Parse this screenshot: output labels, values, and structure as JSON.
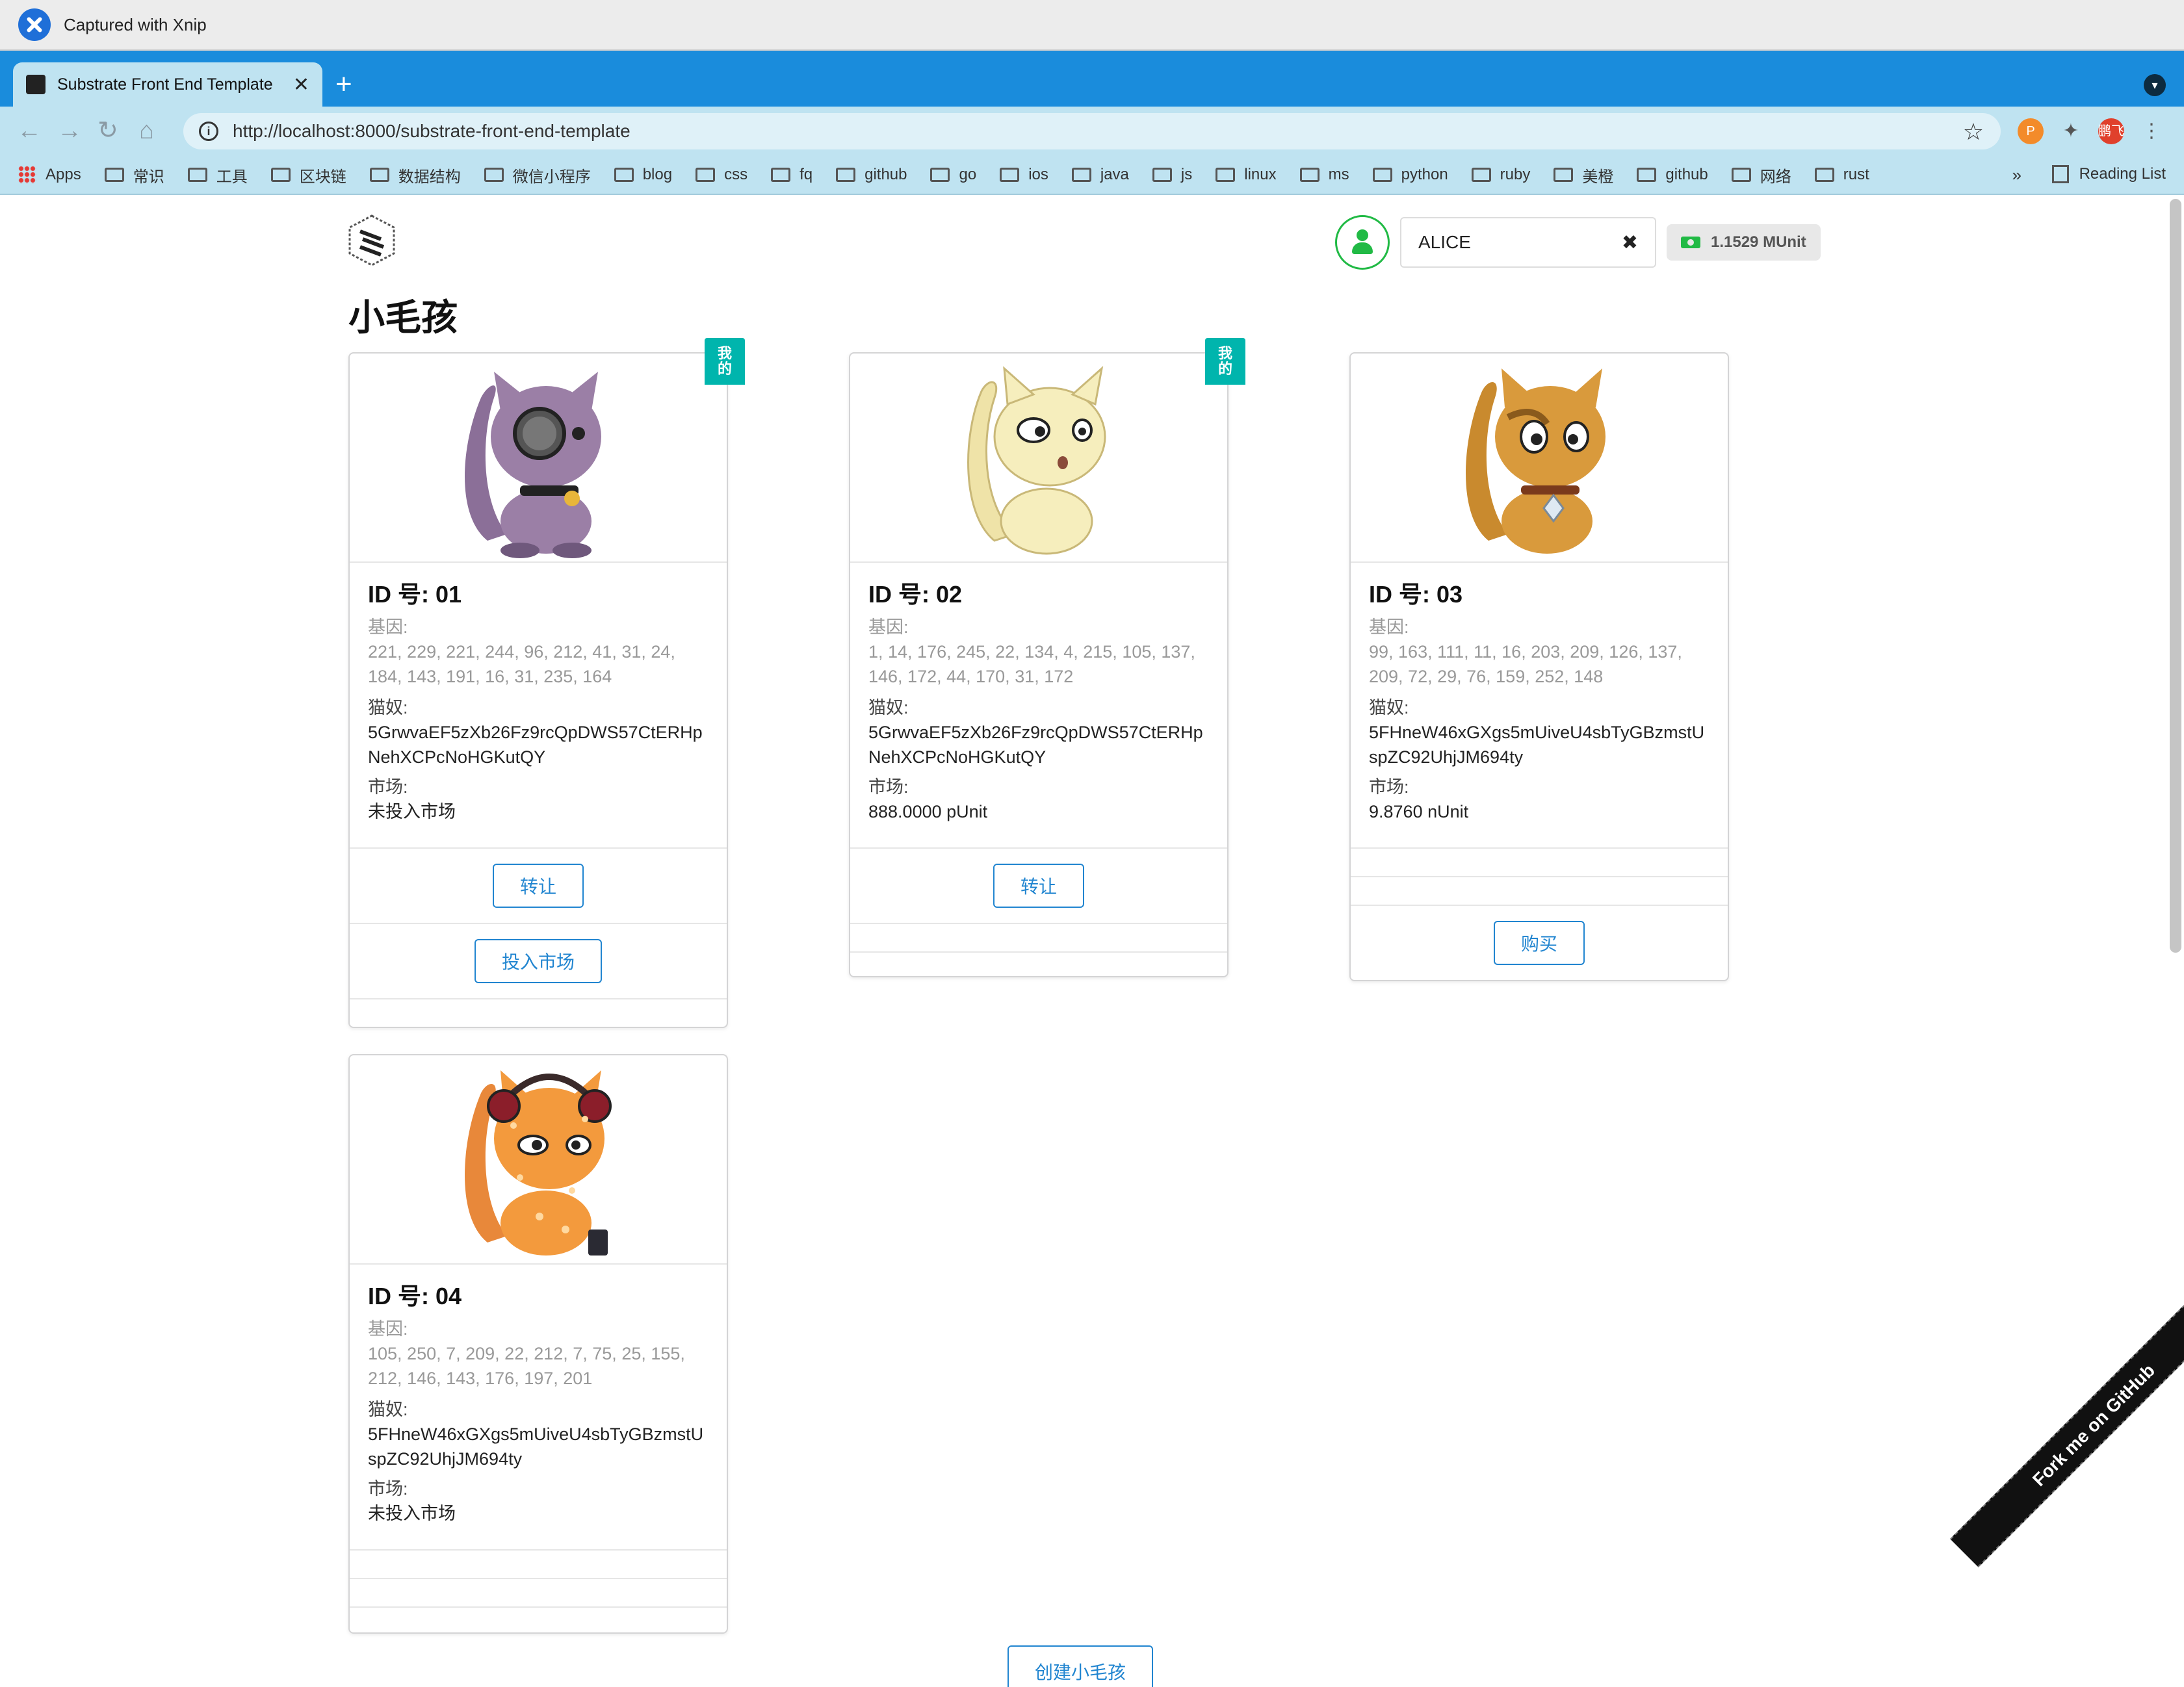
{
  "capture": {
    "title": "Captured with Xnip"
  },
  "browser": {
    "tab_title": "Substrate Front End Template",
    "tab_close": "✕",
    "new_tab": "+",
    "url": "http://localhost:8000/substrate-front-end-template",
    "ext_avatar_label": "鹏飞",
    "bookmarks": [
      "Apps",
      "常识",
      "工具",
      "区块链",
      "数据结构",
      "微信小程序",
      "blog",
      "css",
      "fq",
      "github",
      "go",
      "ios",
      "java",
      "js",
      "linux",
      "ms",
      "python",
      "ruby",
      "美橙",
      "github",
      "网络",
      "rust"
    ],
    "bookmarks_more": "»",
    "reading_list": "Reading List"
  },
  "header": {
    "account_name": "ALICE",
    "clear_icon": "✖",
    "balance": "1.1529 MUnit"
  },
  "page": {
    "title": "小毛孩",
    "create_button": "创建小毛孩",
    "fork_ribbon": "Fork me on GitHub"
  },
  "labels": {
    "gene": "基因:",
    "owner": "猫奴:",
    "market": "市场:",
    "mine_badge": "我的"
  },
  "kitties": [
    {
      "id": "ID 号: 01",
      "gene": "221, 229, 221, 244, 96, 212, 41, 31, 24, 184, 143, 191, 16, 31, 235, 164",
      "owner": "5GrwvaEF5zXb26Fz9rcQpDWS57CtERHpNehXCPcNoHGKutQY",
      "market": "未投入市场",
      "mine": true,
      "color": "#9b7fa6",
      "buttons": [
        "转让",
        "投入市场"
      ]
    },
    {
      "id": "ID 号: 02",
      "gene": "1, 14, 176, 245, 22, 134, 4, 215, 105, 137, 146, 172, 44, 170, 31, 172",
      "owner": "5GrwvaEF5zXb26Fz9rcQpDWS57CtERHpNehXCPcNoHGKutQY",
      "market": "888.0000 pUnit",
      "mine": true,
      "color": "#f6eebd",
      "buttons": [
        "转让"
      ]
    },
    {
      "id": "ID 号: 03",
      "gene": "99, 163, 111, 11, 16, 203, 209, 126, 137, 209, 72, 29, 76, 159, 252, 148",
      "owner": "5FHneW46xGXgs5mUiveU4sbTyGBzmstUspZC92UhjJM694ty",
      "market": "9.8760 nUnit",
      "mine": false,
      "color": "#d99a3c",
      "buttons": [
        "购买"
      ]
    },
    {
      "id": "ID 号: 04",
      "gene": "105, 250, 7, 209, 22, 212, 7, 75, 25, 155, 212, 146, 143, 176, 197, 201",
      "owner": "5FHneW46xGXgs5mUiveU4sbTyGBzmstUspZC92UhjJM694ty",
      "market": "未投入市场",
      "mine": false,
      "color": "#f39a3d",
      "buttons": []
    }
  ]
}
